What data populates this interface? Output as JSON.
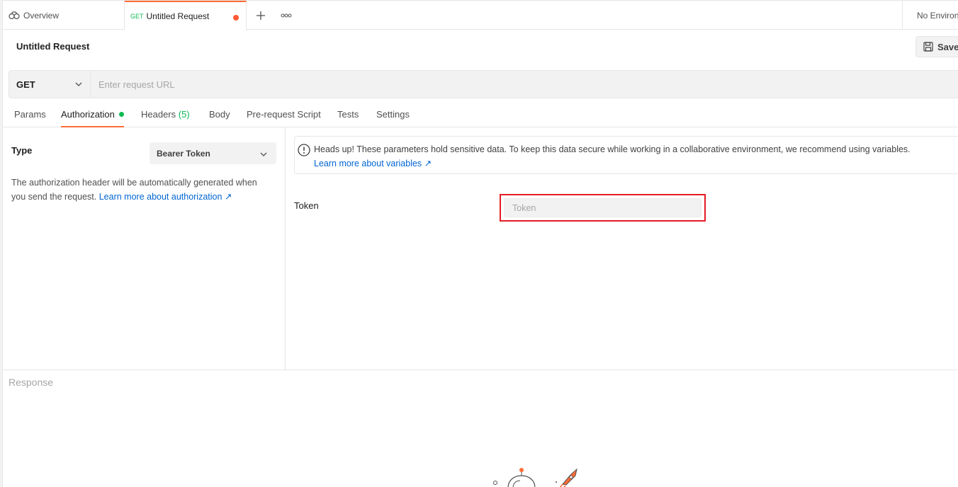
{
  "tabs": {
    "overview_label": "Overview",
    "request_method": "GET",
    "request_label": "Untitled Request",
    "environment_label": "No Environment"
  },
  "request": {
    "title": "Untitled Request",
    "save_label": "Save",
    "method": "GET",
    "url_placeholder": "Enter request URL",
    "url_value": ""
  },
  "subtabs": {
    "params": "Params",
    "authorization": "Authorization",
    "headers": "Headers",
    "headers_count": "(5)",
    "body": "Body",
    "prerequest": "Pre-request Script",
    "tests": "Tests",
    "settings": "Settings"
  },
  "auth": {
    "type_label": "Type",
    "type_value": "Bearer Token",
    "description": "The authorization header will be automatically generated when you send the request.",
    "description_link": "Learn more about authorization ↗",
    "notice_text": "Heads up! These parameters hold sensitive data. To keep this data secure while working in a collaborative environment, we recommend using variables.",
    "notice_link": "Learn more about variables ↗",
    "token_label": "Token",
    "token_placeholder": "Token",
    "token_value": ""
  },
  "response": {
    "label": "Response"
  },
  "colors": {
    "accent": "#ff6c37",
    "success": "#0cbb52",
    "link": "#0265d2",
    "highlight": "#e31b23"
  }
}
